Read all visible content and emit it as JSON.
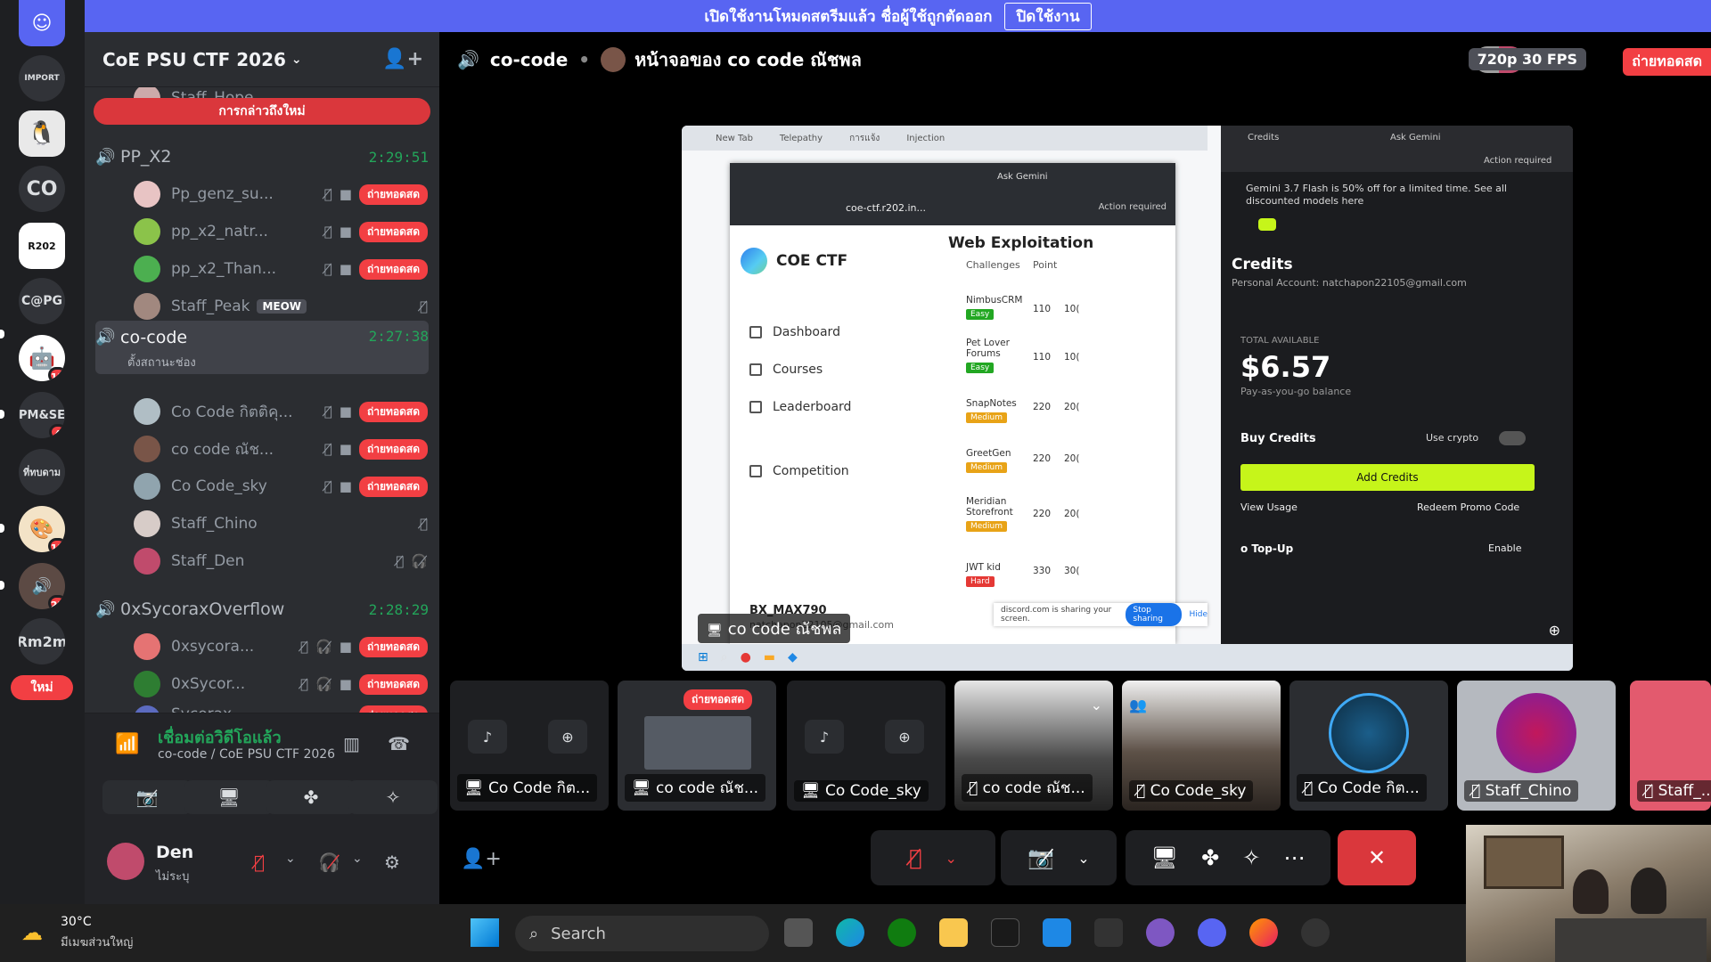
{
  "banner": {
    "text": "เปิดใช้งานโหมดสตรีมแล้ว ชื่อผู้ใช้ถูกตัดออก",
    "button": "ปิดใช้งาน"
  },
  "servers": {
    "items": [
      {
        "label": "",
        "badge": ""
      },
      {
        "label": "IMPORT",
        "badge": ""
      },
      {
        "label": "",
        "badge": ""
      },
      {
        "label": "CO",
        "badge": ""
      },
      {
        "label": "R202",
        "badge": ""
      },
      {
        "label": "C@PG",
        "badge": ""
      },
      {
        "label": "",
        "badge": "12"
      },
      {
        "label": "PM&SE",
        "badge": "4"
      },
      {
        "label": "ที่ทบดาม",
        "badge": ""
      },
      {
        "label": "",
        "badge": "13"
      },
      {
        "label": "",
        "badge": "22"
      },
      {
        "label": "Rm2m",
        "badge": ""
      }
    ],
    "new_label": "ใหม่"
  },
  "sidebar": {
    "server_name": "CoE PSU CTF 2026",
    "top_member": "Staff_Hope",
    "mention_bar": "การกล่าวถึงใหม่",
    "channels": [
      {
        "name": "PP_X2",
        "time": "2:29:51"
      },
      {
        "name": "co-code",
        "time": "2:27:38",
        "sub": "ตั้งสถานะช่อง"
      },
      {
        "name": "0xSycoraxOverflow",
        "time": "2:28:29"
      }
    ],
    "pp_members": [
      {
        "name": "Pp_genz_su...",
        "live": "ถ่ายทอดสด"
      },
      {
        "name": "pp_x2_natr...",
        "live": "ถ่ายทอดสด"
      },
      {
        "name": "pp_x2_Than...",
        "live": "ถ่ายทอดสด"
      },
      {
        "name": "Staff_Peak",
        "tag": "MEOW"
      }
    ],
    "co_members": [
      {
        "name": "Co Code กิตติคุ...",
        "live": "ถ่ายทอดสด"
      },
      {
        "name": "co code ณัช...",
        "live": "ถ่ายทอดสด"
      },
      {
        "name": "Co Code_sky",
        "live": "ถ่ายทอดสด"
      },
      {
        "name": "Staff_Chino"
      },
      {
        "name": "Staff_Den"
      }
    ],
    "sy_members": [
      {
        "name": "0xsycora...",
        "live": "ถ่ายทอดสด"
      },
      {
        "name": "0xSycor...",
        "live": "ถ่ายทอดสด"
      },
      {
        "name": "Sycorax...",
        "live": "ถ่ายทอดสด"
      }
    ]
  },
  "voice_panel": {
    "status": "เชื่อมต่อวิดีโอแล้ว",
    "channel": "co-code / CoE PSU CTF 2026"
  },
  "user": {
    "name": "Den",
    "status": "ไม่ระบุ"
  },
  "stage": {
    "channel": "co-code",
    "screen_title": "หน้าจอของ co code ณัชพล",
    "quality": "720p 30 FPS",
    "live": "ถ่ายทอดสด",
    "screen_label": "co code ณัชพล"
  },
  "shared": {
    "tabs": [
      "New Tab",
      "Telepathy",
      "การแจ้ง",
      "Injection"
    ],
    "url": "coe-ctf.r202.in...",
    "action": "Action required",
    "ask": "Ask Gemini",
    "brand": "COE CTF",
    "nav": [
      "Dashboard",
      "Courses",
      "Leaderboard",
      "Competition"
    ],
    "account": "BX_MAX790",
    "email": "natchapon22105@gmail.com",
    "section": "Web Exploitation",
    "col_challenges": "Challenges",
    "col_point": "Point",
    "challenges": [
      {
        "name": "NimbusCRM",
        "points": "110",
        "p2": "10(",
        "diff": "Easy"
      },
      {
        "name": "Pet Lover Forums",
        "points": "110",
        "p2": "10(",
        "diff": "Easy"
      },
      {
        "name": "SnapNotes",
        "points": "220",
        "p2": "20(",
        "diff": "Medium"
      },
      {
        "name": "GreetGen",
        "points": "220",
        "p2": "20(",
        "diff": "Medium"
      },
      {
        "name": "Meridian Storefront",
        "points": "220",
        "p2": "20(",
        "diff": "Medium"
      },
      {
        "name": "JWT kid",
        "points": "330",
        "p2": "30(",
        "diff": "Hard"
      }
    ],
    "gemini": {
      "tab": "Credits",
      "promo": "Gemini 3.7 Flash is 50% off for a limited time. See all discounted models here",
      "title": "Credits",
      "account": "Personal Account: natchapon22105@gmail.com",
      "total_label": "TOTAL AVAILABLE",
      "total": "$6.57",
      "payg": "Pay-as-you-go balance",
      "buy": "Buy Credits",
      "crypto": "Use crypto",
      "add": "Add Credits",
      "usage": "View Usage",
      "redeem": "Redeem Promo Code",
      "topup": "o Top-Up",
      "enable": "Enable"
    },
    "sharing_text": "discord.com is sharing your screen.",
    "stop": "Stop sharing",
    "hide": "Hide"
  },
  "tiles": [
    {
      "name": "Co Code กิต..."
    },
    {
      "name": "co code ณัช...",
      "live": "ถ่ายทอดสด"
    },
    {
      "name": "Co Code_sky"
    },
    {
      "name": "co code ณัช..."
    },
    {
      "name": "Co Code_sky"
    },
    {
      "name": "Co Code กิต..."
    },
    {
      "name": "Staff_Chino"
    },
    {
      "name": "Staff_..."
    }
  ],
  "taskbar": {
    "temp": "30°C",
    "weather": "มีเมฆส่วนใหญ่",
    "search": "Search"
  }
}
